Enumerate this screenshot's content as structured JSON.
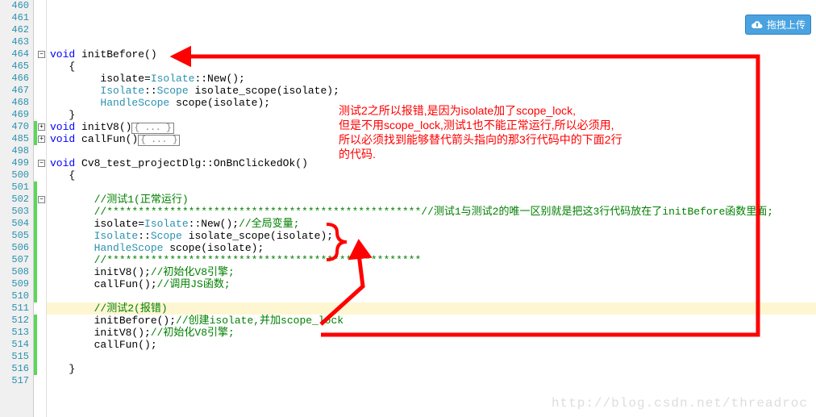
{
  "upload": {
    "label": "拖拽上传"
  },
  "watermark": "http://blog.csdn.net/threadroc",
  "lines": {
    "l460": "460",
    "l461": "461",
    "l462": "462",
    "l463": "463",
    "l464": "464",
    "l465": "465",
    "l466": "466",
    "l467": "467",
    "l468": "468",
    "l469": "469",
    "l470": "470",
    "l485": "485",
    "l498": "498",
    "l499": "499",
    "l500": "500",
    "l501": "501",
    "l502": "502",
    "l503": "503",
    "l504": "504",
    "l505": "505",
    "l506": "506",
    "l507": "507",
    "l508": "508",
    "l509": "509",
    "l510": "510",
    "l511": "511",
    "l512": "512",
    "l513": "513",
    "l514": "514",
    "l515": "515",
    "l516": "516",
    "l517": "517"
  },
  "code": {
    "kw_void": "void",
    "fn_initBefore": " initBefore()",
    "brace_open": "   {",
    "l466": "        isolate=",
    "l466b": "Isolate",
    "l466c": "::New();",
    "l467a": "        ",
    "l467b": "Isolate",
    "l467c": "::",
    "l467d": "Scope",
    "l467e": " isolate_scope(isolate);",
    "l468a": "        ",
    "l468b": "HandleScope",
    "l468c": " scope(isolate);",
    "brace_close": "   }",
    "fn_initV8": " initV8()",
    "fn_callFun": " callFun()",
    "folded": "{ ... }",
    "fn_project": " Cv8_test_projectDlg::OnBnClickedOk()",
    "c502": "       //测试1(正常运行)",
    "c503a": "       //**************************************************",
    "c503b": "//测试1与测试2的唯一区别就是把这3行代码放在了initBefore函数里面;",
    "l504a": "       isolate=",
    "l504b": "Isolate",
    "l504c": "::New();",
    "l504d": "//全局变量;",
    "l505a": "       ",
    "l505b": "Isolate",
    "l505c": "::",
    "l505d": "Scope",
    "l505e": " isolate_scope(isolate);",
    "l506a": "       ",
    "l506b": "HandleScope",
    "l506c": " scope(isolate);",
    "c507": "       //**************************************************",
    "l508a": "       initV8();",
    "l508b": "//初始化V8引擎;",
    "l509a": "       callFun();",
    "l509b": "//调用JS函数;",
    "c511": "       //测试2(报错)",
    "l512a": "       initBefore();",
    "l512b": "//创建isolate,并加scope_lock",
    "l513a": "       initV8();",
    "l513b": "//初始化V8引擎;",
    "l514": "       callFun();"
  },
  "annot": {
    "line1": "测试2之所以报错,是因为isolate加了scope_lock,",
    "line2": "但是不用scope_lock,测试1也不能正常运行,所以必须用,",
    "line3": "所以必须找到能够替代箭头指向的那3行代码中的下面2行",
    "line4": "的代码."
  }
}
